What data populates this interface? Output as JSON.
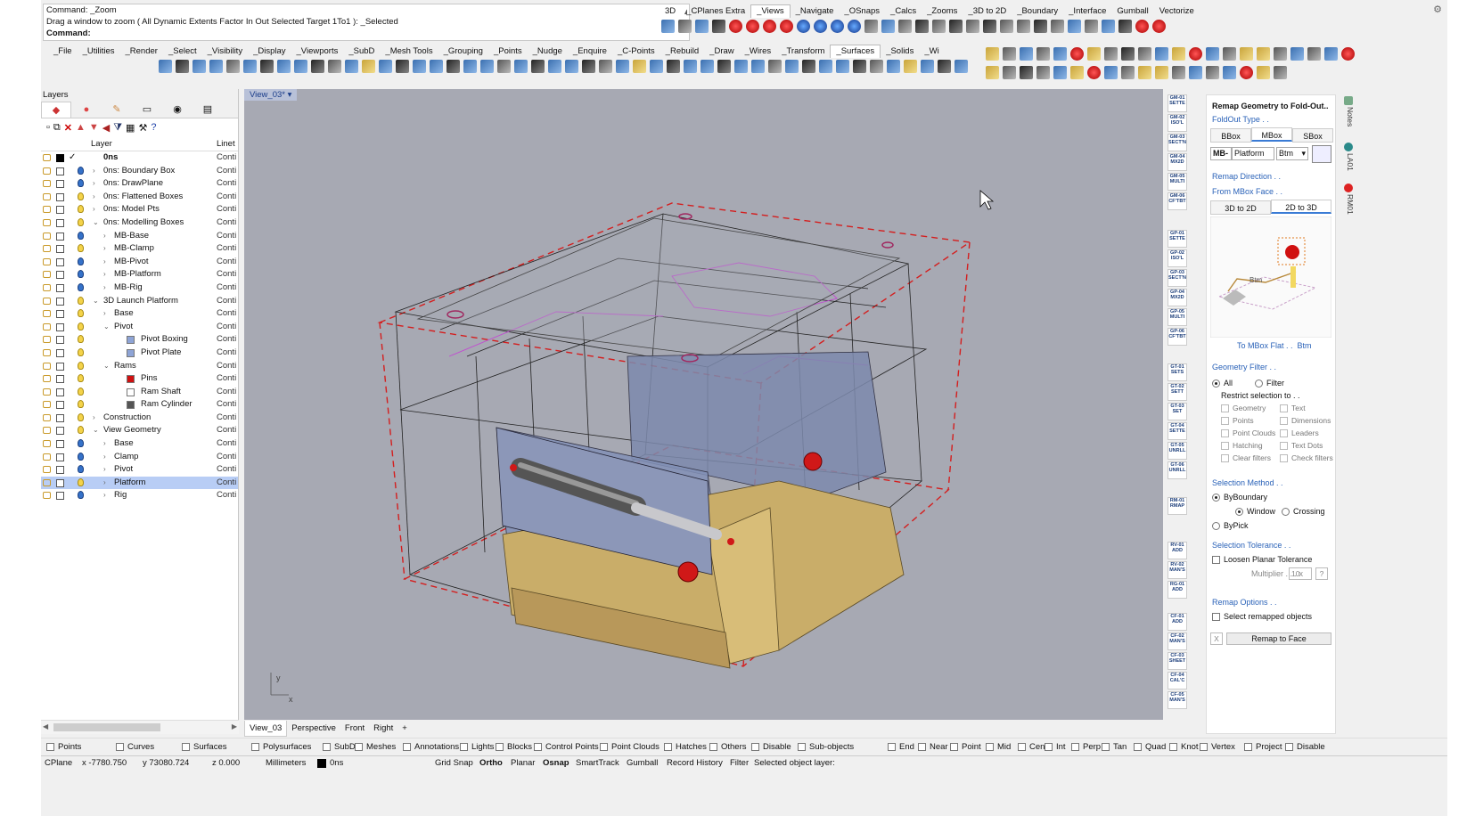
{
  "command": {
    "line1": "Command: _Zoom",
    "line2": "Drag a window to zoom ( All  Dynamic  Extents  Factor  In  Out  Selected  Target  1To1 ): _Selected",
    "line3": "Command:"
  },
  "toolbar_tabs_top": [
    "3D",
    "_CPlanes Extra",
    "_Views",
    "_Navigate",
    "_OSnaps",
    "_Calcs",
    "_Zooms",
    "_3D to 2D",
    "_Boundary",
    "_Interface",
    "Gumball",
    "Vectorize"
  ],
  "menu_tabs": [
    "_File",
    "_Utilities",
    "_Render",
    "_Select",
    "_Visibility",
    "_Display",
    "_Viewports",
    "_SubD",
    "_Mesh Tools",
    "_Grouping",
    "_Points",
    "_Nudge",
    "_Enquire",
    "_C-Points",
    "_Rebuild",
    "_Draw",
    "_Wires",
    "_Transform",
    "_Surfaces",
    "_Solids",
    "_Wi"
  ],
  "layers": {
    "panel_title": "Layers",
    "col_layer": "Layer",
    "col_linetype": "Linet",
    "rows": [
      {
        "name": "0ns",
        "linetype": "Conti",
        "indent": 0,
        "expander": "",
        "current": true,
        "bulb": "none",
        "swatch": "#000000"
      },
      {
        "name": "0ns: Boundary Box",
        "linetype": "Conti",
        "indent": 0,
        "expander": ">",
        "bulb": "blue"
      },
      {
        "name": "0ns: DrawPlane",
        "linetype": "Conti",
        "indent": 0,
        "expander": ">",
        "bulb": "blue"
      },
      {
        "name": "0ns: Flattened Boxes",
        "linetype": "Conti",
        "indent": 0,
        "expander": ">",
        "bulb": "yellow"
      },
      {
        "name": "0ns: Model Pts",
        "linetype": "Conti",
        "indent": 0,
        "expander": ">",
        "bulb": "yellow"
      },
      {
        "name": "0ns: Modelling Boxes",
        "linetype": "Conti",
        "indent": 0,
        "expander": "v",
        "bulb": "yellow"
      },
      {
        "name": "MB-Base",
        "linetype": "Conti",
        "indent": 1,
        "expander": ">",
        "bulb": "blue"
      },
      {
        "name": "MB-Clamp",
        "linetype": "Conti",
        "indent": 1,
        "expander": ">",
        "bulb": "yellow"
      },
      {
        "name": "MB-Pivot",
        "linetype": "Conti",
        "indent": 1,
        "expander": ">",
        "bulb": "blue"
      },
      {
        "name": "MB-Platform",
        "linetype": "Conti",
        "indent": 1,
        "expander": ">",
        "bulb": "blue"
      },
      {
        "name": "MB-Rig",
        "linetype": "Conti",
        "indent": 1,
        "expander": ">",
        "bulb": "blue"
      },
      {
        "name": "3D Launch Platform",
        "linetype": "Conti",
        "indent": 0,
        "expander": "v",
        "bulb": "yellow"
      },
      {
        "name": "Base",
        "linetype": "Conti",
        "indent": 1,
        "expander": ">",
        "bulb": "yellow"
      },
      {
        "name": "Pivot",
        "linetype": "Conti",
        "indent": 1,
        "expander": "v",
        "bulb": "yellow"
      },
      {
        "name": "Pivot Boxing",
        "linetype": "Conti",
        "indent": 2,
        "expander": "",
        "bulb": "yellow",
        "swatch": "#8ea4d6"
      },
      {
        "name": "Pivot Plate",
        "linetype": "Conti",
        "indent": 2,
        "expander": "",
        "bulb": "yellow",
        "swatch": "#8ea4d6"
      },
      {
        "name": "Rams",
        "linetype": "Conti",
        "indent": 1,
        "expander": "v",
        "bulb": "yellow"
      },
      {
        "name": "Pins",
        "linetype": "Conti",
        "indent": 2,
        "expander": "",
        "bulb": "yellow",
        "swatch": "#d01010"
      },
      {
        "name": "Ram Shaft",
        "linetype": "Conti",
        "indent": 2,
        "expander": "",
        "bulb": "yellow",
        "swatch": "#ffffff"
      },
      {
        "name": "Ram Cylinder",
        "linetype": "Conti",
        "indent": 2,
        "expander": "",
        "bulb": "yellow",
        "swatch": "#555555"
      },
      {
        "name": "Construction",
        "linetype": "Conti",
        "indent": 0,
        "expander": ">",
        "bulb": "yellow"
      },
      {
        "name": "View Geometry",
        "linetype": "Conti",
        "indent": 0,
        "expander": "v",
        "bulb": "yellow"
      },
      {
        "name": "Base",
        "linetype": "Conti",
        "indent": 1,
        "expander": ">",
        "bulb": "blue"
      },
      {
        "name": "Clamp",
        "linetype": "Conti",
        "indent": 1,
        "expander": ">",
        "bulb": "blue"
      },
      {
        "name": "Pivot",
        "linetype": "Conti",
        "indent": 1,
        "expander": ">",
        "bulb": "blue"
      },
      {
        "name": "Platform",
        "linetype": "Conti",
        "indent": 1,
        "expander": ">",
        "bulb": "yellow",
        "selected": true
      },
      {
        "name": "Rig",
        "linetype": "Conti",
        "indent": 1,
        "expander": ">",
        "bulb": "blue"
      }
    ]
  },
  "viewport": {
    "title": "View_03*",
    "axis_y": "y",
    "axis_x": "x"
  },
  "view_tabs": [
    "View_03",
    "Perspective",
    "Front",
    "Right",
    "+"
  ],
  "side_buttons": [
    "GM-01 SETTE",
    "GM-02 ISO'L",
    "GM-03 SECT'N",
    "GM-04 MX2D",
    "GM-05 MULTI",
    "GM-06 CF'TBT",
    "GP-01 SETTE",
    "GP-02 ISO'L",
    "GP-03 SECT'N",
    "GP-04 MX2D",
    "GP-05 MULTI",
    "GP-06 CF'TBT",
    "GT-01 SETS",
    "GT-02 SETT",
    "GT-03 SET",
    "GT-04 SETTE",
    "GT-05 UNRLL",
    "GT-06 UNRLL",
    "RM-01 RMAP",
    "RV-01 ADD",
    "RV-02 MAN'S",
    "RG-01 ADD",
    "CF-01 ADD",
    "CF-02 MAN'S",
    "CF-03 SHEET",
    "CF-04 CAL'C",
    "CF-05 MAN'S"
  ],
  "remap": {
    "title": "Remap Geometry to Fold-Out..",
    "foldout_type": "FoldOut Type . .",
    "type_tabs": [
      "BBox",
      "MBox",
      "SBox"
    ],
    "mb_label": "MB-",
    "mb_value": "Platform",
    "mb_face": "Btm",
    "remap_direction": "Remap Direction . .",
    "from_face": "From MBox Face . .",
    "dir_tabs": [
      "3D to 2D",
      "2D to 3D"
    ],
    "diagram_label": "Btm",
    "to_flat": "To MBox Flat . .",
    "to_flat_value": "Btm",
    "geometry_filter": "Geometry Filter . .",
    "all": "All",
    "filter": "Filter",
    "restrict": "Restrict selection to . .",
    "filters_left": [
      "Geometry",
      "Points",
      "Point Clouds",
      "Hatching",
      "Clear filters"
    ],
    "filters_right": [
      "Text",
      "Dimensions",
      "Leaders",
      "Text Dots",
      "Check filters"
    ],
    "selection_method": "Selection Method . .",
    "by_boundary": "ByBoundary",
    "window": "Window",
    "crossing": "Crossing",
    "by_pick": "ByPick",
    "selection_tolerance": "Selection Tolerance . .",
    "loosen": "Loosen Planar Tolerance",
    "multiplier": "Multiplier . . . x",
    "multiplier_value": "10",
    "help": "?",
    "remap_options": "Remap Options . .",
    "select_remapped": "Select remapped objects",
    "x_button": "X",
    "remap_button": "Remap to Face"
  },
  "side_tabs": [
    "Notes",
    "LA01",
    "RM01"
  ],
  "filters": {
    "items": [
      "Points",
      "Curves",
      "Surfaces",
      "Polysurfaces",
      "SubDs",
      "Meshes",
      "Annotations",
      "Lights",
      "Blocks",
      "Control Points",
      "Point Clouds",
      "Hatches",
      "Others",
      "Disable",
      "Sub-objects"
    ],
    "osnaps": [
      "End",
      "Near",
      "Point",
      "Mid",
      "Cen",
      "Int",
      "Perp",
      "Tan",
      "Quad",
      "Knot",
      "Vertex",
      "Project",
      "Disable"
    ]
  },
  "status": {
    "cplane": "CPlane",
    "x": "x -7780.750",
    "y": "y 73080.724",
    "z": "z 0.000",
    "units": "Millimeters",
    "layer": "0ns",
    "grid_snap": "Grid Snap",
    "ortho": "Ortho",
    "planar": "Planar",
    "osnap": "Osnap",
    "smarttrack": "SmartTrack",
    "gumball": "Gumball",
    "record_history": "Record History",
    "filter": "Filter",
    "message": "Selected object layer:"
  }
}
